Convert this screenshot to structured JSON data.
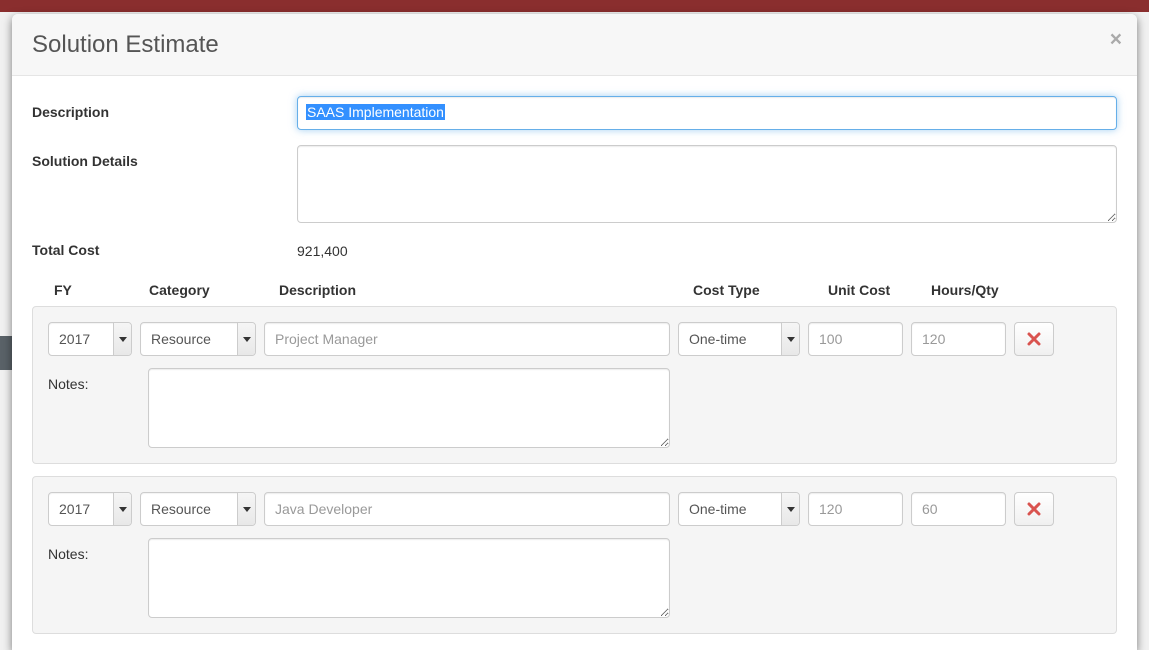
{
  "modal": {
    "title": "Solution Estimate",
    "close_icon": "×"
  },
  "form": {
    "description_label": "Description",
    "description_value": "SAAS Implementation",
    "solution_details_label": "Solution Details",
    "solution_details_value": "",
    "total_cost_label": "Total Cost",
    "total_cost_value": "921,400"
  },
  "cost_headers": {
    "fy": "FY",
    "category": "Category",
    "description": "Description",
    "cost_type": "Cost Type",
    "unit_cost": "Unit Cost",
    "hours_qty": "Hours/Qty"
  },
  "notes_label": "Notes:",
  "rows": [
    {
      "fy": "2017",
      "category": "Resource",
      "description": "Project Manager",
      "cost_type": "One-time",
      "unit_cost": "100",
      "hours_qty": "120",
      "notes": ""
    },
    {
      "fy": "2017",
      "category": "Resource",
      "description": "Java Developer",
      "cost_type": "One-time",
      "unit_cost": "120",
      "hours_qty": "60",
      "notes": ""
    }
  ]
}
